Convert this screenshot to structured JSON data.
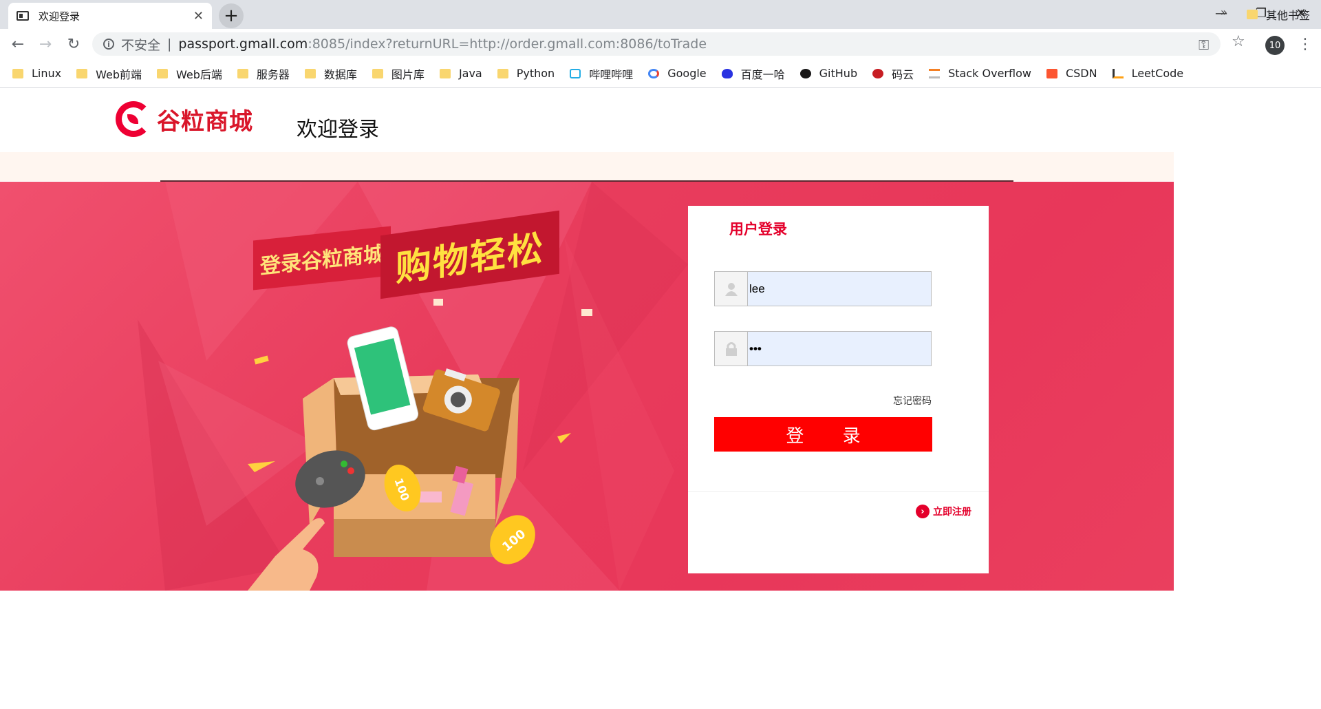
{
  "browser": {
    "tab_title": "欢迎登录",
    "new_tab": "+",
    "insecure_label": "不安全",
    "url_host": "passport.gmall.com",
    "url_rest": ":8085/index?returnURL=http://order.gmall.com:8086/toTrade",
    "profile_badge": "10",
    "bookmarks": [
      {
        "label": "Linux",
        "icon": "folder-icon"
      },
      {
        "label": "Web前端",
        "icon": "folder-icon"
      },
      {
        "label": "Web后端",
        "icon": "folder-icon"
      },
      {
        "label": "服务器",
        "icon": "folder-icon"
      },
      {
        "label": "数据库",
        "icon": "folder-icon"
      },
      {
        "label": "图片库",
        "icon": "folder-icon"
      },
      {
        "label": "Java",
        "icon": "folder-icon"
      },
      {
        "label": "Python",
        "icon": "folder-icon"
      },
      {
        "label": "哔哩哔哩",
        "icon": "bilibili-icon"
      },
      {
        "label": "Google",
        "icon": "google-icon"
      },
      {
        "label": "百度一哈",
        "icon": "baidu-icon"
      },
      {
        "label": "GitHub",
        "icon": "github-icon"
      },
      {
        "label": "码云",
        "icon": "gitee-icon"
      },
      {
        "label": "Stack Overflow",
        "icon": "stackoverflow-icon"
      },
      {
        "label": "CSDN",
        "icon": "csdn-icon"
      },
      {
        "label": "LeetCode",
        "icon": "leetcode-icon"
      }
    ],
    "other_bookmarks": "其他书签",
    "more": "»"
  },
  "page": {
    "logo_text": "谷粒商城",
    "title": "欢迎登录",
    "banner_small": "登录谷粒商城",
    "banner_big": "购物轻松"
  },
  "login": {
    "title": "用户登录",
    "username": "lee",
    "password": "•••",
    "forgot": "忘记密码",
    "submit": "登 录",
    "register": "立即注册"
  },
  "colors": {
    "brand_red": "#e4002b",
    "button_red": "#ff0000",
    "hero_bg": "#e8375a",
    "autofill_bg": "#e8f0fe"
  }
}
